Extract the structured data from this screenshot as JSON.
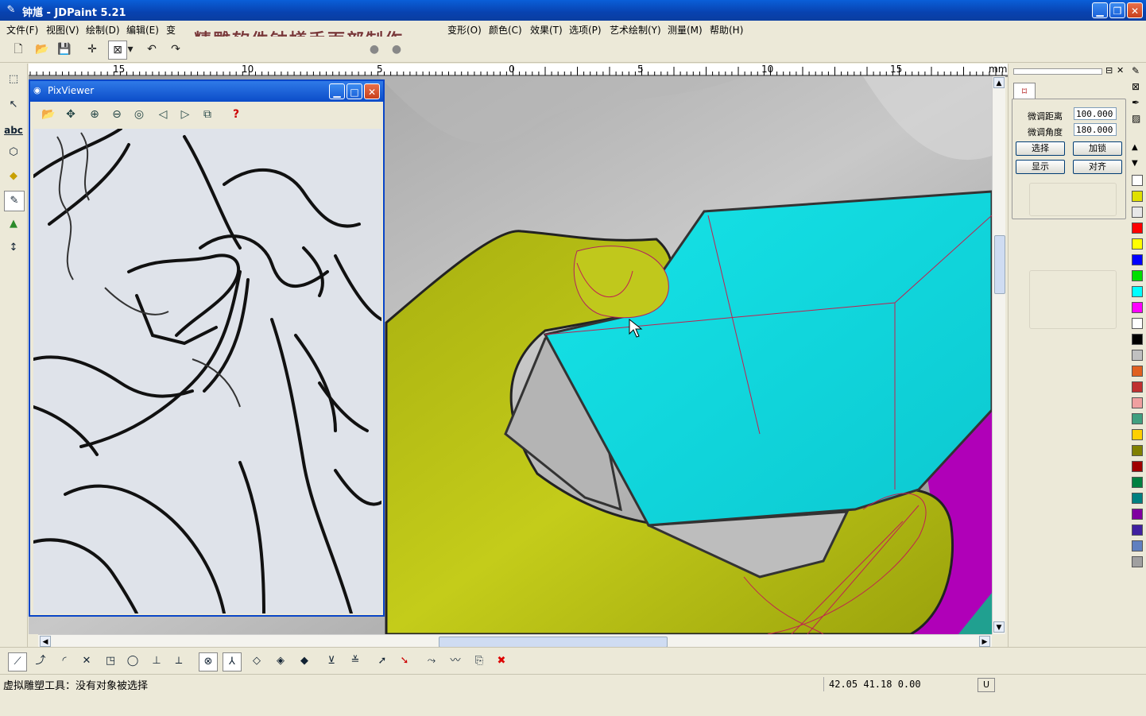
{
  "window": {
    "title": "钟馗 - JDPaint 5.21"
  },
  "menu": [
    "文件(F)",
    "视图(V)",
    "绘制(D)",
    "编辑(E)",
    "变",
    "变形(O)",
    "颜色(C)",
    "效果(T)",
    "选项(P)",
    "艺术绘制(Y)",
    "测量(M)",
    "帮助(H)"
  ],
  "overlay_caption": "精雕软件钟馗手面部制作",
  "ruler": {
    "ticks": [
      "15",
      "10",
      "5",
      "0",
      "5",
      "10",
      "15"
    ],
    "unit": "mm"
  },
  "pixviewer": {
    "title": "PixViewer",
    "help": "?"
  },
  "panel": {
    "fine_distance_label": "微调距离",
    "fine_distance_value": "100.000",
    "fine_angle_label": "微调角度",
    "fine_angle_value": "180.000",
    "btn_select": "选择",
    "btn_lock": "加锁",
    "btn_show": "显示",
    "btn_align": "对齐"
  },
  "palette": [
    "#ffffff",
    "#e0e000",
    "#e8e8e8",
    "#ff0000",
    "#ffff00",
    "#0000ff",
    "#00e000",
    "#00ffff",
    "#ff00ff",
    "#ffffff",
    "#000000",
    "#c0c0c0",
    "#e06020",
    "#c03030",
    "#f0a0a0",
    "#40a080",
    "#ffd000",
    "#808000",
    "#a00000",
    "#008040",
    "#008080",
    "#8000a0",
    "#4020a0",
    "#6080c0",
    "#a0a0a0"
  ],
  "status": {
    "text": "虚拟雕塑工具：没有对象被选择",
    "coords": "42.05 41.18 0.00",
    "mode": "U"
  },
  "colors": {
    "accent": "#0a5fd8",
    "cyan_block": "#10dce0",
    "yellow_hand": "#b8c014",
    "magenta": "#b000b8"
  }
}
